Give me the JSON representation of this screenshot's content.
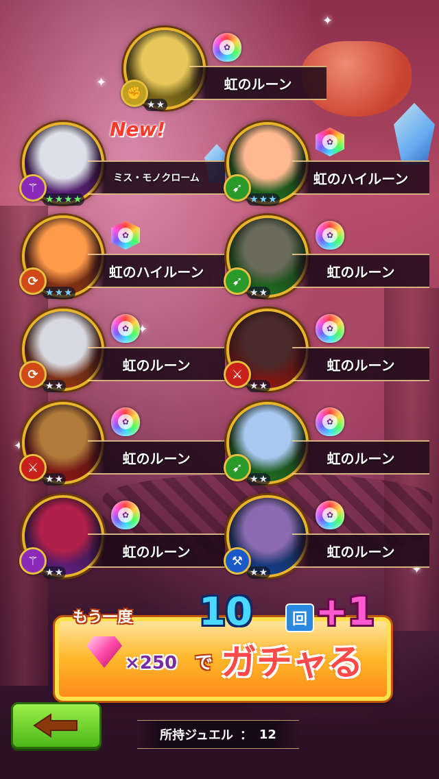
{
  "results": [
    {
      "name": "虹のルーン",
      "rune": "rainbow-rune",
      "stars": 2,
      "star_colors": [
        "silver",
        "silver"
      ],
      "type": "fist",
      "type_color": "#c0a020",
      "portrait_color": "#e8c85a"
    },
    {
      "name": "ミス・モノクローム",
      "new_badge": "New!",
      "rune": "none",
      "stars": 4,
      "star_colors": [
        "green",
        "green",
        "green",
        "green"
      ],
      "type": "staff",
      "type_color": "#8a2ab8",
      "portrait_color": "#dde0ea"
    },
    {
      "name": "虹のハイルーン",
      "rune": "rainbow-high-rune",
      "stars": 3,
      "star_colors": [
        "blue",
        "blue",
        "blue"
      ],
      "type": "spear",
      "type_color": "#2a9a2a",
      "portrait_color": "#ffb890"
    },
    {
      "name": "虹のハイルーン",
      "rune": "rainbow-high-rune",
      "stars": 3,
      "star_colors": [
        "blue",
        "blue",
        "blue"
      ],
      "type": "bow",
      "type_color": "#d04a18",
      "portrait_color": "#ff9a4a"
    },
    {
      "name": "虹のルーン",
      "rune": "rainbow-rune",
      "stars": 2,
      "star_colors": [
        "silver",
        "silver"
      ],
      "type": "spear",
      "type_color": "#2a9a2a",
      "portrait_color": "#6a6a5a"
    },
    {
      "name": "虹のルーン",
      "rune": "rainbow-rune",
      "stars": 2,
      "star_colors": [
        "silver",
        "silver"
      ],
      "type": "bow",
      "type_color": "#d04a18",
      "portrait_color": "#d8d8e0"
    },
    {
      "name": "虹のルーン",
      "rune": "rainbow-rune",
      "stars": 2,
      "star_colors": [
        "silver",
        "silver"
      ],
      "type": "sword",
      "type_color": "#c8201a",
      "portrait_color": "#4a2a2a"
    },
    {
      "name": "虹のルーン",
      "rune": "rainbow-rune",
      "stars": 2,
      "star_colors": [
        "silver",
        "silver"
      ],
      "type": "sword",
      "type_color": "#c8201a",
      "portrait_color": "#b07a3a"
    },
    {
      "name": "虹のルーン",
      "rune": "rainbow-rune",
      "stars": 2,
      "star_colors": [
        "silver",
        "silver"
      ],
      "type": "spear",
      "type_color": "#2a9a2a",
      "portrait_color": "#a8c8f0"
    },
    {
      "name": "虹のルーン",
      "rune": "rainbow-rune",
      "stars": 2,
      "star_colors": [
        "silver",
        "silver"
      ],
      "type": "staff",
      "type_color": "#8a2ab8",
      "portrait_color": "#b0204a"
    },
    {
      "name": "虹のルーン",
      "rune": "rainbow-rune",
      "stars": 2,
      "star_colors": [
        "silver",
        "silver"
      ],
      "type": "axe",
      "type_color": "#1a5ac8",
      "portrait_color": "#8a6ab0"
    }
  ],
  "gacha_banner": {
    "again_label": "もう一度",
    "count_label": "10",
    "kai_label": "回",
    "bonus_label": "+1",
    "cost_label": "×250",
    "de_label": "で",
    "action_label": "ガチャる",
    "gem_icon": "pink-jewel-icon"
  },
  "back_button": {
    "icon": "left-arrow-icon",
    "arrow_color": "#8a3a0a"
  },
  "jewel_status": {
    "label": "所持ジュエル",
    "separator": "：",
    "value": "12"
  },
  "colors": {
    "gold_frame": "#e8b52a",
    "accent_pink": "#ff4aa8",
    "back_green": "#4cb81a"
  }
}
